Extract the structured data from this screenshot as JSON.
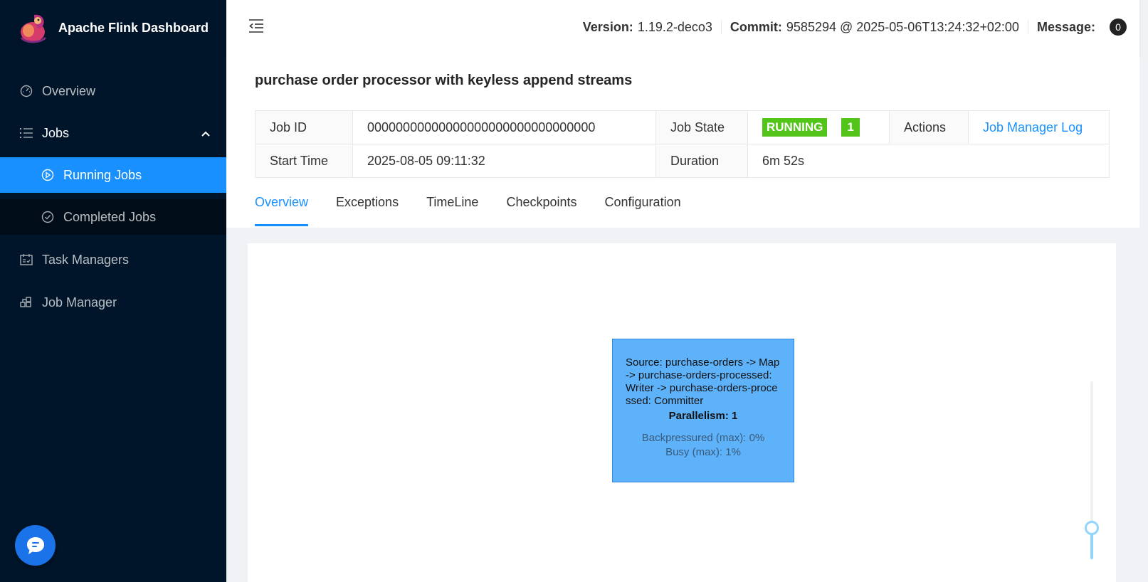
{
  "app": {
    "title": "Apache Flink Dashboard"
  },
  "sidebar": {
    "items": [
      {
        "label": "Overview",
        "icon": "dashboard-icon"
      },
      {
        "label": "Jobs",
        "icon": "list-icon"
      },
      {
        "label": "Running Jobs",
        "icon": "play-circle-icon"
      },
      {
        "label": "Completed Jobs",
        "icon": "check-circle-icon"
      },
      {
        "label": "Task Managers",
        "icon": "schedule-icon"
      },
      {
        "label": "Job Manager",
        "icon": "build-icon"
      }
    ],
    "active": "Running Jobs"
  },
  "header": {
    "version_label": "Version:",
    "version": "1.19.2-deco3",
    "commit_label": "Commit:",
    "commit": "9585294 @ 2025-05-06T13:24:32+02:00",
    "message_label": "Message:",
    "message_count": "0"
  },
  "job": {
    "title": "purchase order processor with keyless append streams",
    "job_id_label": "Job ID",
    "job_id": "00000000000000000000000000000000",
    "job_state_label": "Job State",
    "job_state": "RUNNING",
    "job_state_count": "1",
    "actions_label": "Actions",
    "action_link": "Job Manager Log",
    "start_time_label": "Start Time",
    "start_time": "2025-08-05 09:11:32",
    "duration_label": "Duration",
    "duration": "6m 52s"
  },
  "tabs": [
    "Overview",
    "Exceptions",
    "TimeLine",
    "Checkpoints",
    "Configuration"
  ],
  "active_tab": "Overview",
  "graph": {
    "node": {
      "name": "Source: purchase-orders -> Map -> purchase-orders-processed: Writer -> purchase-orders-processed: Committer",
      "parallelism": "Parallelism: 1",
      "backpressured": "Backpressured (max): 0%",
      "busy": "Busy (max): 1%"
    },
    "zoom_level": 0.0
  },
  "colors": {
    "sidebar": "#001529",
    "accent": "#1890ff",
    "running": "#52c41a",
    "node": "#5eb2fa"
  }
}
